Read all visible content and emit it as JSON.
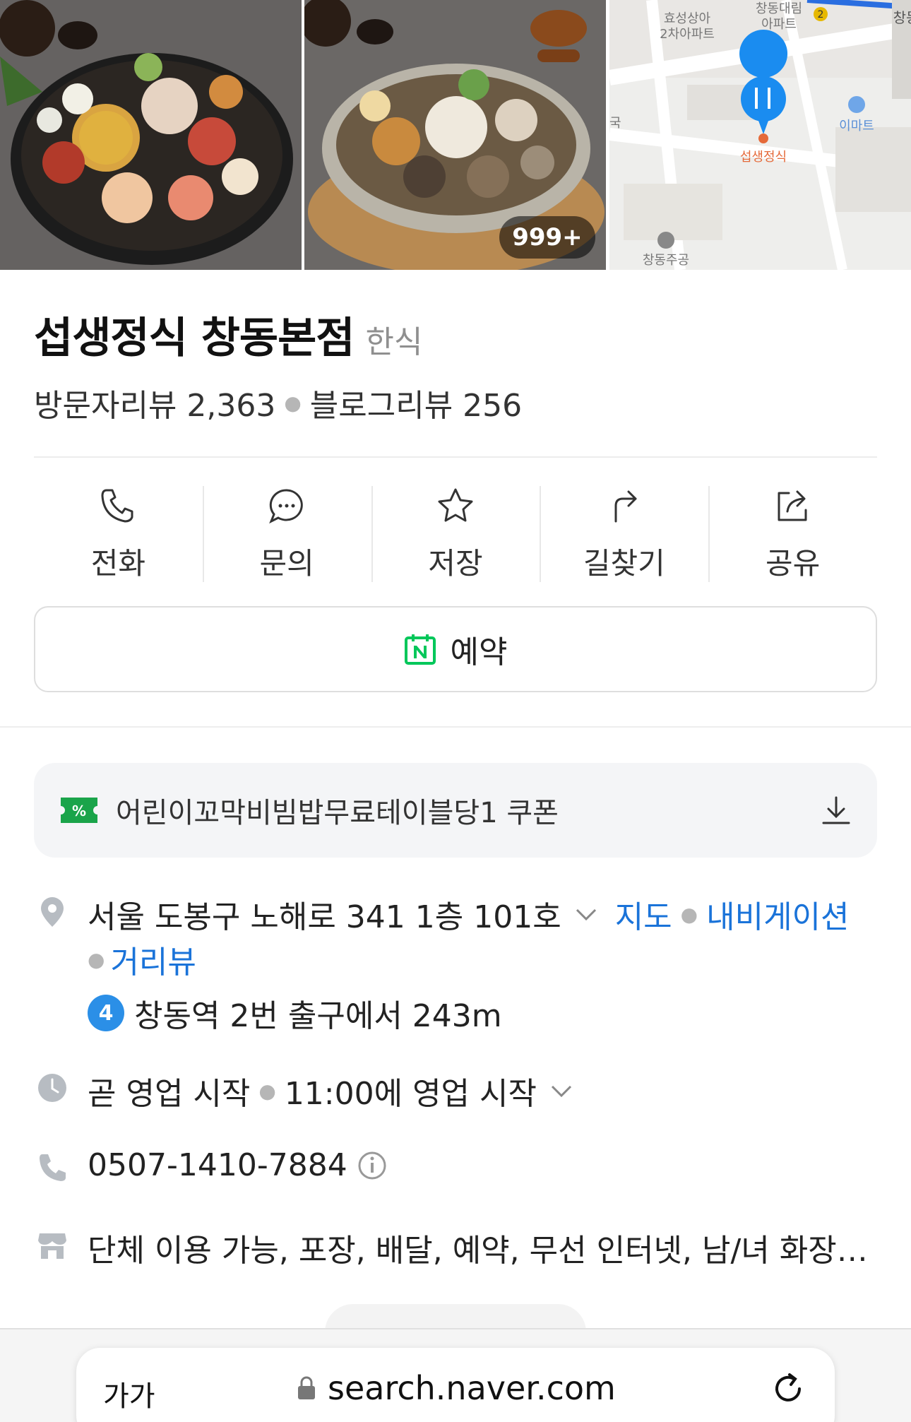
{
  "photos": {
    "count_badge": "999+",
    "map_labels": {
      "building_1": "효성상아",
      "building_1b": "2차아파트",
      "building_2": "창동대림",
      "building_2b": "아파트",
      "station_edge": "창동",
      "mart": "이마트",
      "pin_label": "섭생정식",
      "school": "창동주공",
      "left_edge": "국"
    }
  },
  "place": {
    "name": "섭생정식 창동본점",
    "category": "한식",
    "visitor_reviews": "방문자리뷰 2,363",
    "blog_reviews": "블로그리뷰 256"
  },
  "actions": [
    {
      "label": "전화",
      "icon": "phone-icon"
    },
    {
      "label": "문의",
      "icon": "chat-bubble-icon"
    },
    {
      "label": "저장",
      "icon": "star-icon"
    },
    {
      "label": "길찾기",
      "icon": "directions-arrow-icon"
    },
    {
      "label": "공유",
      "icon": "share-icon"
    }
  ],
  "reserve": {
    "label": "예약",
    "icon": "naver-calendar-icon"
  },
  "coupon": {
    "text": "어린이꼬막비빔밥무료테이블당1 쿠폰",
    "icon": "coupon-icon"
  },
  "address": {
    "text": "서울 도봉구 노해로 341 1층 101호",
    "map_link": "지도",
    "nav_link": "내비게이션",
    "street_link": "거리뷰",
    "subway_line": "4",
    "subway_text": "창동역 2번 출구에서 243m"
  },
  "hours": {
    "status": "곧 영업 시작",
    "detail": "11:00에 영업 시작"
  },
  "phone": {
    "number": "0507-1410-7884"
  },
  "amenities": {
    "text": "단체 이용 가능, 포장, 배달, 예약, 무선 인터넷, 남/녀 화장실…"
  },
  "browser": {
    "text_size": "가가",
    "url": "search.naver.com"
  },
  "colors": {
    "link": "#1a73d9",
    "naver_green": "#03c75a",
    "pin_blue": "#1a8cf0",
    "subway_line4": "#2b8fe7"
  }
}
